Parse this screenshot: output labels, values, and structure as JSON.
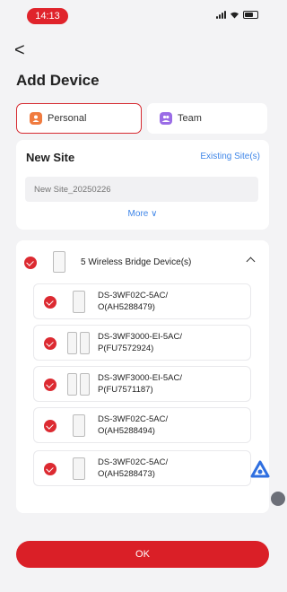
{
  "status_bar": {
    "time": "14:13"
  },
  "header": {
    "back_glyph": "<",
    "title": "Add Device"
  },
  "tabs": [
    {
      "label": "Personal",
      "icon": "person-icon",
      "selected": true
    },
    {
      "label": "Team",
      "icon": "team-icon",
      "selected": false
    }
  ],
  "site": {
    "title": "New Site",
    "existing_label": "Existing Site(s)",
    "name_placeholder": "New Site_20250226",
    "more_label": "More ∨"
  },
  "devices": {
    "group_label": "5 Wireless Bridge Device(s)",
    "items": [
      {
        "line1": "DS-3WF02C-5AC/",
        "line2": "O(AH5288479)",
        "icon": "single-device-icon"
      },
      {
        "line1": "DS-3WF3000-EI-5AC/",
        "line2": "P(FU7572924)",
        "icon": "pair-device-icon"
      },
      {
        "line1": "DS-3WF3000-EI-5AC/",
        "line2": "P(FU7571187)",
        "icon": "pair-device-icon"
      },
      {
        "line1": "DS-3WF02C-5AC/",
        "line2": "O(AH5288494)",
        "icon": "single-device-icon"
      },
      {
        "line1": "DS-3WF02C-5AC/",
        "line2": "O(AH5288473)",
        "icon": "single-device-icon"
      }
    ]
  },
  "ok_button": {
    "label": "OK"
  },
  "colors": {
    "accent": "#da1f27",
    "link": "#3f86e8",
    "background": "#f3f3f5"
  }
}
